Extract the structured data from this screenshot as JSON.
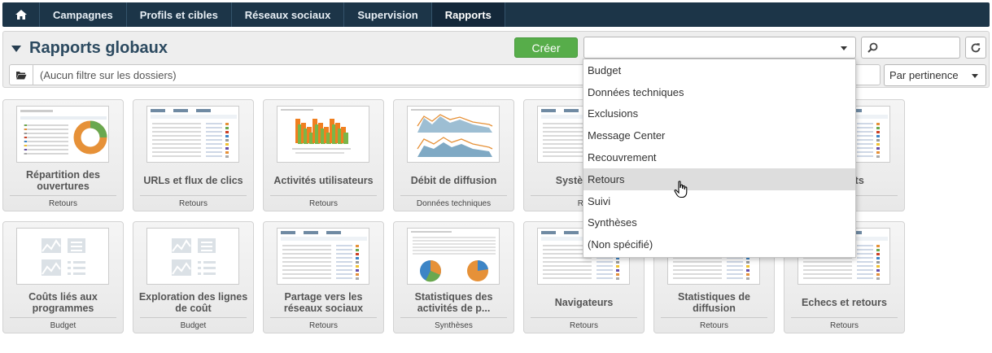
{
  "nav": {
    "items": [
      {
        "label": "Campagnes",
        "active": false
      },
      {
        "label": "Profils et cibles",
        "active": false
      },
      {
        "label": "Réseaux sociaux",
        "active": false
      },
      {
        "label": "Supervision",
        "active": false
      },
      {
        "label": "Rapports",
        "active": true
      }
    ]
  },
  "header": {
    "title": "Rapports globaux",
    "create_label": "Créer",
    "category_select_value": "",
    "search_value": "",
    "filter_text": "(Aucun filtre sur les dossiers)",
    "sort_value": "Par pertinence"
  },
  "dropdown": {
    "options": [
      "Budget",
      "Données techniques",
      "Exclusions",
      "Message Center",
      "Recouvrement",
      "Retours",
      "Suivi",
      "Synthèses",
      "(Non spécifié)"
    ],
    "hovered": "Retours"
  },
  "reports": [
    {
      "title": "Répartition des ouvertures",
      "category": "Retours",
      "thumb": "donut"
    },
    {
      "title": "URLs et flux de clics",
      "category": "Retours",
      "thumb": "table"
    },
    {
      "title": "Activités utilisateurs",
      "category": "Retours",
      "thumb": "bars3d"
    },
    {
      "title": "Débit de diffusion",
      "category": "Données techniques",
      "thumb": "area"
    },
    {
      "title": "Systèmes d",
      "category": "Ret",
      "thumb": "table"
    },
    {
      "title": "budgets",
      "category": "",
      "thumb": "table"
    },
    {
      "title": "Coûts liés aux programmes",
      "category": "Budget",
      "thumb": "placeholder"
    },
    {
      "title": "Exploration des lignes de coût",
      "category": "Budget",
      "thumb": "placeholder"
    },
    {
      "title": "Partage vers les réseaux sociaux",
      "category": "Retours",
      "thumb": "table"
    },
    {
      "title": "Statistiques des activités de p...",
      "category": "Synthèses",
      "thumb": "pies"
    },
    {
      "title": "Navigateurs",
      "category": "Retours",
      "thumb": "table"
    },
    {
      "title": "Statistiques de diffusion",
      "category": "Retours",
      "thumb": "table"
    },
    {
      "title": "Echecs et retours",
      "category": "Retours",
      "thumb": "table"
    }
  ],
  "colors": {
    "nav_bg": "#1c3548",
    "create_green": "#57ad4a",
    "title_blue": "#2c4a60"
  }
}
